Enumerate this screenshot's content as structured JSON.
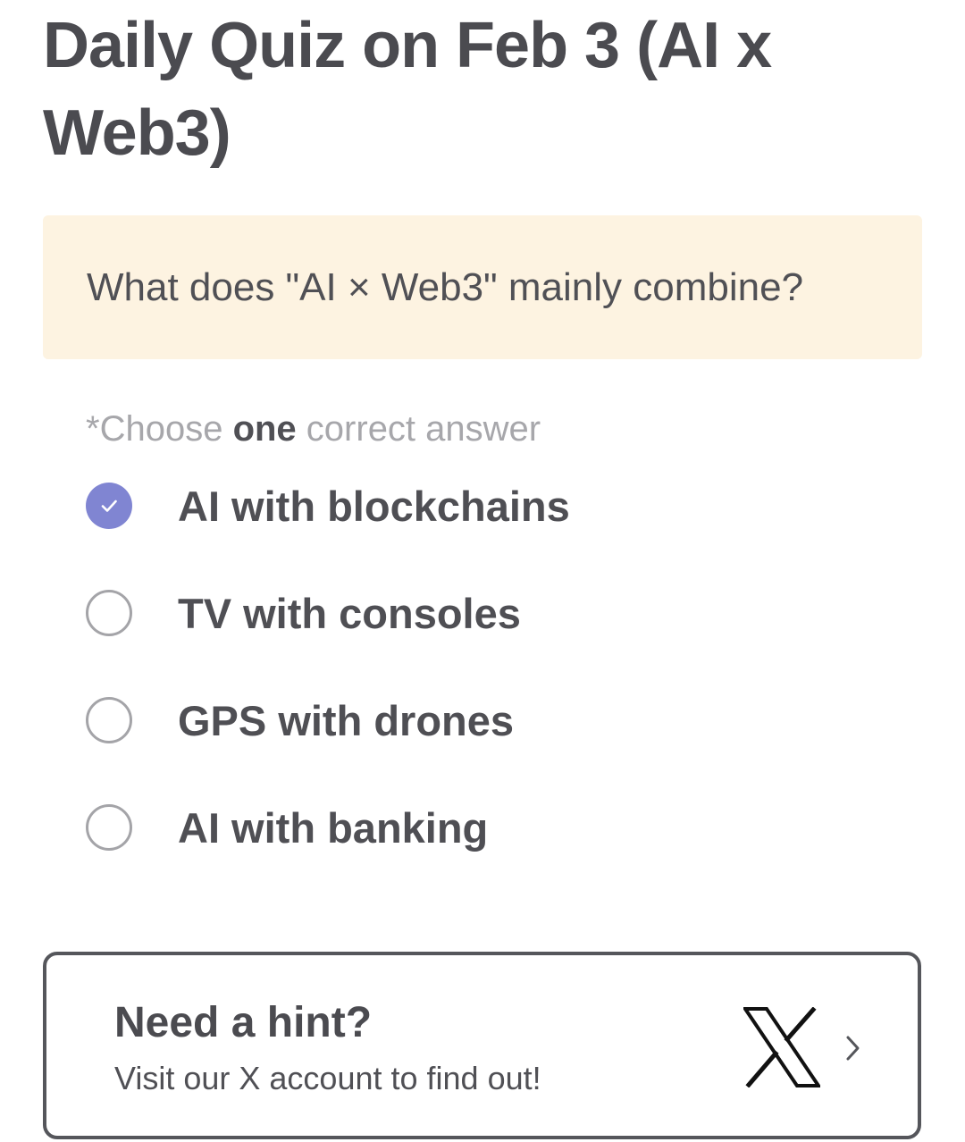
{
  "quiz": {
    "title": "Daily Quiz on Feb 3 (AI x Web3)",
    "question": "What does \"AI × Web3\" mainly combine?",
    "instruction": {
      "prefix": "*Choose ",
      "emphasis": "one",
      "suffix": " correct answer"
    },
    "options": [
      {
        "label": "AI with blockchains",
        "selected": true
      },
      {
        "label": "TV with consoles",
        "selected": false
      },
      {
        "label": "GPS with drones",
        "selected": false
      },
      {
        "label": "AI with banking",
        "selected": false
      }
    ]
  },
  "hint": {
    "title": "Need a hint?",
    "subtitle": "Visit our X account to find out!",
    "icon": "x-logo-icon",
    "chevron_icon": "chevron-right-icon"
  },
  "colors": {
    "accent": "#8085d2",
    "question_bg": "#fdf3e1",
    "text": "#4b4b50",
    "muted": "#a7a7ab"
  }
}
